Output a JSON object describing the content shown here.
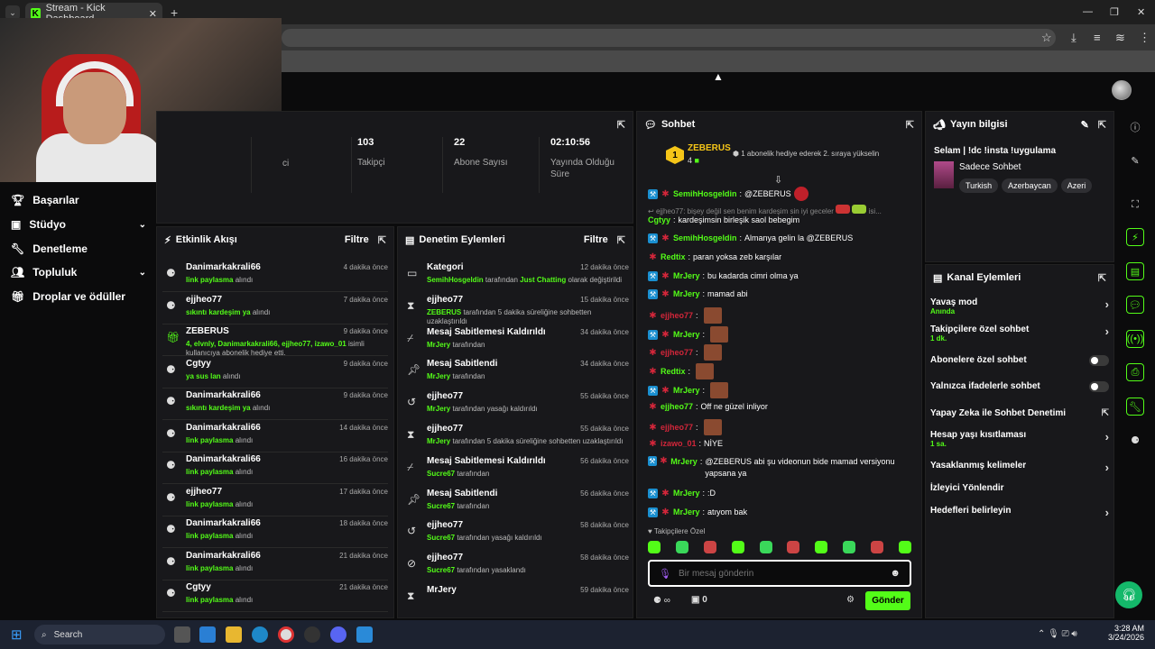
{
  "browser": {
    "tab_title": "Stream - Kick Dashboard",
    "tab_favicon": "K"
  },
  "nav": {
    "items": [
      {
        "label": "Başarılar",
        "icon": "trophy-icon"
      },
      {
        "label": "Stüdyo",
        "icon": "studio-icon",
        "chevron": true
      },
      {
        "label": "Denetleme",
        "icon": "wrench-icon"
      },
      {
        "label": "Topluluk",
        "icon": "community-icon",
        "chevron": true
      },
      {
        "label": "Droplar ve ödüller",
        "icon": "gift-icon"
      }
    ]
  },
  "stats": [
    {
      "value": "",
      "label": "ci"
    },
    {
      "value": "103",
      "label": "Takipçi"
    },
    {
      "value": "22",
      "label": "Abone Sayısı"
    },
    {
      "value": "02:10:56",
      "label": "Yayında Olduğu Süre"
    }
  ],
  "activity": {
    "title": "Etkinlik Akışı",
    "filter": "Filtre",
    "rows": [
      {
        "name": "Danimarkakrali66",
        "time": "4 dakika önce",
        "hl": "link paylasma",
        "rest": " alındı"
      },
      {
        "name": "ejjheo77",
        "time": "7 dakika önce",
        "hl": "sıkıntı kardeşim ya",
        "rest": " alındı"
      },
      {
        "name": "ZEBERUS",
        "time": "9 dakika önce",
        "hl": "4, elvnly, Danimarkakrali66, ejjheo77, izawo_01",
        "rest": " isimli kullanıcıya abonelik hediye etti."
      },
      {
        "name": "Cgtyy",
        "time": "9 dakika önce",
        "hl": "ya sus lan",
        "rest": " alındı"
      },
      {
        "name": "Danimarkakrali66",
        "time": "9 dakika önce",
        "hl": "sıkıntı kardeşim ya",
        "rest": " alındı"
      },
      {
        "name": "Danimarkakrali66",
        "time": "14 dakika önce",
        "hl": "link paylasma",
        "rest": " alındı"
      },
      {
        "name": "Danimarkakrali66",
        "time": "16 dakika önce",
        "hl": "link paylasma",
        "rest": " alındı"
      },
      {
        "name": "ejjheo77",
        "time": "17 dakika önce",
        "hl": "link paylasma",
        "rest": " alındı"
      },
      {
        "name": "Danimarkakrali66",
        "time": "18 dakika önce",
        "hl": "link paylasma",
        "rest": " alındı"
      },
      {
        "name": "Danimarkakrali66",
        "time": "21 dakika önce",
        "hl": "link paylasma",
        "rest": " alındı"
      },
      {
        "name": "Cgtyy",
        "time": "21 dakika önce",
        "hl": "link paylasma",
        "rest": " alındı"
      }
    ]
  },
  "mod": {
    "title": "Denetim Eylemleri",
    "filter": "Filtre",
    "rows": [
      {
        "icon": "category-icon",
        "name": "Kategori",
        "time": "12 dakika önce",
        "hl": "SemihHosgeldin",
        "rest": " tarafından ",
        "hl2": "Just Chatting",
        "rest2": " olarak değiştirildi"
      },
      {
        "icon": "timer-icon",
        "name": "ejjheo77",
        "time": "15 dakika önce",
        "hl": "ZEBERUS",
        "rest": " tarafından 5 dakika süreliğine sohbetten uzaklaştırıldı",
        "hl2": "",
        "rest2": ""
      },
      {
        "icon": "unpin-icon",
        "name": "Mesaj Sabitlemesi Kaldırıldı",
        "time": "34 dakika önce",
        "hl": "MrJery",
        "rest": " tarafından",
        "hl2": "",
        "rest2": ""
      },
      {
        "icon": "pin-icon",
        "name": "Mesaj Sabitlendi",
        "time": "34 dakika önce",
        "hl": "MrJery",
        "rest": " tarafından",
        "hl2": "",
        "rest2": ""
      },
      {
        "icon": "unban-icon",
        "name": "ejjheo77",
        "time": "55 dakika önce",
        "hl": "MrJery",
        "rest": " tarafından yasağı kaldırıldı",
        "hl2": "",
        "rest2": ""
      },
      {
        "icon": "timer-icon",
        "name": "ejjheo77",
        "time": "55 dakika önce",
        "hl": "MrJery",
        "rest": " tarafından 5 dakika süreliğine sohbetten uzaklaştırıldı",
        "hl2": "",
        "rest2": ""
      },
      {
        "icon": "unpin-icon",
        "name": "Mesaj Sabitlemesi Kaldırıldı",
        "time": "56 dakika önce",
        "hl": "Sucre67",
        "rest": " tarafından",
        "hl2": "",
        "rest2": ""
      },
      {
        "icon": "pin-icon",
        "name": "Mesaj Sabitlendi",
        "time": "56 dakika önce",
        "hl": "Sucre67",
        "rest": " tarafından",
        "hl2": "",
        "rest2": ""
      },
      {
        "icon": "unban-icon",
        "name": "ejjheo77",
        "time": "58 dakika önce",
        "hl": "Sucre67",
        "rest": " tarafından yasağı kaldırıldı",
        "hl2": "",
        "rest2": ""
      },
      {
        "icon": "ban-icon",
        "name": "ejjheo77",
        "time": "58 dakika önce",
        "hl": "Sucre67",
        "rest": " tarafından yasaklandı",
        "hl2": "",
        "rest2": ""
      },
      {
        "icon": "timer-icon",
        "name": "MrJery",
        "time": "59 dakika önce",
        "hl": "",
        "rest": "",
        "hl2": "",
        "rest2": ""
      }
    ]
  },
  "chat": {
    "title": "Sohbet",
    "top_user": "ZEBERUS",
    "top_rank": "1",
    "top_count": "4",
    "gift_note": "1 abonelik hediye ederek 2. sıraya yükselin",
    "reply": "ejjheo77: bişey değil sen benim kardeşim sin iyi geceler",
    "reply_more": "isi...",
    "messages": [
      {
        "user": "SemihHosgeldin",
        "color": "#53fc18",
        "text": "@ZEBERUS",
        "emote": true,
        "badges": 2
      },
      {
        "user": "Cgtyy",
        "color": "#53fc18",
        "text": "kardeşimsin birleşik saol bebegim",
        "emote": false,
        "badges": 0
      },
      {
        "user": "SemihHosgeldin",
        "color": "#53fc18",
        "text": "Almanya gelin la @ZEBERUS",
        "emote": false,
        "badges": 2
      },
      {
        "user": "Redtix",
        "color": "#53fc18",
        "text": "paran yoksa zeb karşılar",
        "emote": false,
        "badges": 1
      },
      {
        "user": "MrJery",
        "color": "#53fc18",
        "text": "bu kadarda cimri olma ya",
        "emote": false,
        "badges": 2
      },
      {
        "user": "MrJery",
        "color": "#53fc18",
        "text": "mamad abi",
        "emote": false,
        "badges": 2
      },
      {
        "user": "ejjheo77",
        "color": "#d3263a",
        "text": "",
        "emote": true,
        "badges": 1
      },
      {
        "user": "MrJery",
        "color": "#53fc18",
        "text": "",
        "emote": true,
        "badges": 2
      },
      {
        "user": "ejjheo77",
        "color": "#d3263a",
        "text": "",
        "emote": true,
        "badges": 1
      },
      {
        "user": "Redtix",
        "color": "#53fc18",
        "text": "",
        "emote": true,
        "badges": 1
      },
      {
        "user": "MrJery",
        "color": "#53fc18",
        "text": "",
        "emote": true,
        "badges": 2
      },
      {
        "user": "ejjheo77",
        "color": "#53fc18",
        "text": "Off ne güzel inliyor",
        "emote": false,
        "badges": 1
      },
      {
        "user": "ejjheo77",
        "color": "#d3263a",
        "text": "",
        "emote": true,
        "badges": 1
      },
      {
        "user": "izawo_01",
        "color": "#d3263a",
        "text": "NİYE",
        "emote": false,
        "badges": 1
      },
      {
        "user": "MrJery",
        "color": "#53fc18",
        "text": "@ZEBERUS abi şu videonun bide mamad versiyonu yapsana ya",
        "emote": false,
        "badges": 2
      },
      {
        "user": "MrJery",
        "color": "#53fc18",
        "text": ":D",
        "emote": false,
        "badges": 2
      },
      {
        "user": "MrJery",
        "color": "#53fc18",
        "text": "atıyom bak",
        "emote": false,
        "badges": 2
      }
    ],
    "followers_label": "Takipçilere Özel",
    "placeholder": "Bir mesaj gönderin",
    "points": "0",
    "send": "Gönder"
  },
  "info": {
    "title": "Yayın bilgisi",
    "stream_title": "Selam | !dc !insta !uygulama",
    "category": "Sadece Sohbet",
    "tags": [
      "Turkish",
      "Azerbaycan",
      "Azeri"
    ]
  },
  "actions": {
    "title": "Kanal Eylemleri",
    "items": [
      {
        "label": "Yavaş mod",
        "sub": "Anında",
        "type": "arrow"
      },
      {
        "label": "Takipçilere özel sohbet",
        "sub": "1 dk.",
        "type": "arrow"
      },
      {
        "label": "Abonelere özel sohbet",
        "sub": "",
        "type": "toggle"
      },
      {
        "label": "Yalnızca ifadelerle sohbet",
        "sub": "",
        "type": "toggle"
      },
      {
        "label": "Yapay Zeka ile Sohbet Denetimi",
        "sub": "",
        "type": "external"
      },
      {
        "label": "Hesap yaşı kısıtlaması",
        "sub": "1 sa.",
        "type": "arrow"
      },
      {
        "label": "Yasaklanmış kelimeler",
        "sub": "",
        "type": "arrow"
      },
      {
        "label": "İzleyici Yönlendir",
        "sub": "",
        "type": "none"
      },
      {
        "label": "Hedefleri belirleyin",
        "sub": "",
        "type": "arrow"
      }
    ]
  },
  "taskbar": {
    "search": "Search",
    "time": "3:28 AM",
    "date": "3/24/2026"
  },
  "colors": {
    "accent": "#53fc18",
    "panel": "#18181b",
    "bg": "#0b0b0c"
  }
}
